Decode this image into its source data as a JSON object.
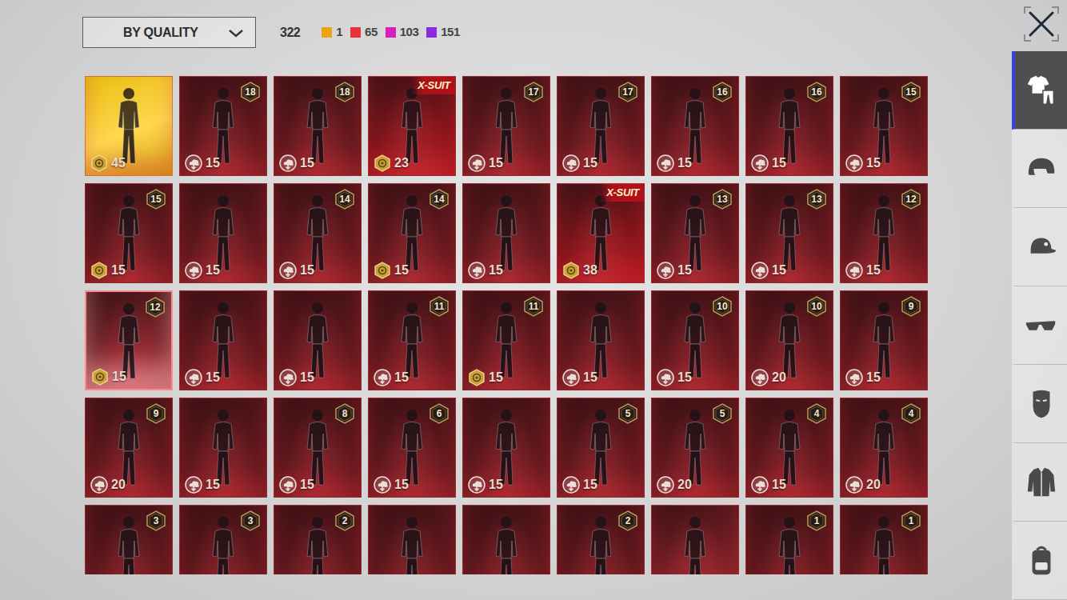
{
  "filter": {
    "label": "BY QUALITY"
  },
  "total": "322",
  "legend": [
    {
      "count": "1",
      "color": "#e8a317"
    },
    {
      "count": "65",
      "color": "#e8313a"
    },
    {
      "count": "103",
      "color": "#d81fbf"
    },
    {
      "count": "151",
      "color": "#8a2be2"
    }
  ],
  "tiles": [
    {
      "color": "#e8b800",
      "selected": false,
      "price": "45",
      "kind": "coin"
    },
    {
      "color": "#6f1b21",
      "selected": false,
      "badge": "18",
      "price": "15",
      "kind": "cloud"
    },
    {
      "color": "#6f1b21",
      "selected": false,
      "badge": "18",
      "price": "15",
      "kind": "cloud"
    },
    {
      "color": "#b3161e",
      "selected": false,
      "tag": "X-SUIT",
      "price": "23",
      "kind": "coin"
    },
    {
      "color": "#6f1b21",
      "selected": false,
      "badge": "17",
      "price": "15",
      "kind": "cloud"
    },
    {
      "color": "#6f1b21",
      "selected": false,
      "badge": "17",
      "price": "15",
      "kind": "cloud"
    },
    {
      "color": "#6f1b21",
      "selected": false,
      "badge": "16",
      "price": "15",
      "kind": "cloud"
    },
    {
      "color": "#6f1b21",
      "selected": false,
      "badge": "16",
      "price": "15",
      "kind": "cloud"
    },
    {
      "color": "#6f1b21",
      "selected": false,
      "badge": "15",
      "price": "15",
      "kind": "cloud"
    },
    {
      "color": "#6f1b21",
      "selected": false,
      "badge": "15",
      "price": "15",
      "kind": "coin"
    },
    {
      "color": "#6f1b21",
      "selected": false,
      "price": "15",
      "kind": "cloud"
    },
    {
      "color": "#6f1b21",
      "selected": false,
      "badge": "14",
      "price": "15",
      "kind": "cloud"
    },
    {
      "color": "#6f1b21",
      "selected": false,
      "badge": "14",
      "price": "15",
      "kind": "coin"
    },
    {
      "color": "#6f1b21",
      "selected": false,
      "price": "15",
      "kind": "cloud"
    },
    {
      "color": "#b3161e",
      "selected": false,
      "tag": "X-SUIT",
      "price": "38",
      "kind": "coin"
    },
    {
      "color": "#6f1b21",
      "selected": false,
      "badge": "13",
      "price": "15",
      "kind": "cloud"
    },
    {
      "color": "#6f1b21",
      "selected": false,
      "badge": "13",
      "price": "15",
      "kind": "cloud"
    },
    {
      "color": "#6f1b21",
      "selected": false,
      "badge": "12",
      "price": "15",
      "kind": "cloud"
    },
    {
      "color": "#a8303a",
      "selected": true,
      "badge": "12",
      "price": "15",
      "kind": "coin"
    },
    {
      "color": "#6f1b21",
      "selected": false,
      "price": "15",
      "kind": "cloud"
    },
    {
      "color": "#6f1b21",
      "selected": false,
      "price": "15",
      "kind": "cloud"
    },
    {
      "color": "#6f1b21",
      "selected": false,
      "badge": "11",
      "price": "15",
      "kind": "cloud"
    },
    {
      "color": "#6f1b21",
      "selected": false,
      "badge": "11",
      "price": "15",
      "kind": "coin"
    },
    {
      "color": "#6f1b21",
      "selected": false,
      "price": "15",
      "kind": "cloud"
    },
    {
      "color": "#6f1b21",
      "selected": false,
      "badge": "10",
      "price": "15",
      "kind": "cloud"
    },
    {
      "color": "#6f1b21",
      "selected": false,
      "badge": "10",
      "price": "20",
      "kind": "cloud"
    },
    {
      "color": "#6f1b21",
      "selected": false,
      "badge": "9",
      "price": "15",
      "kind": "cloud"
    },
    {
      "color": "#6f1b21",
      "selected": false,
      "badge": "9",
      "price": "20",
      "kind": "cloud"
    },
    {
      "color": "#6f1b21",
      "selected": false,
      "price": "15",
      "kind": "cloud"
    },
    {
      "color": "#6f1b21",
      "selected": false,
      "badge": "8",
      "price": "15",
      "kind": "cloud"
    },
    {
      "color": "#6f1b21",
      "selected": false,
      "badge": "6",
      "price": "15",
      "kind": "cloud"
    },
    {
      "color": "#6f1b21",
      "selected": false,
      "price": "15",
      "kind": "cloud"
    },
    {
      "color": "#6f1b21",
      "selected": false,
      "badge": "5",
      "price": "15",
      "kind": "cloud"
    },
    {
      "color": "#6f1b21",
      "selected": false,
      "badge": "5",
      "price": "20",
      "kind": "cloud"
    },
    {
      "color": "#6f1b21",
      "selected": false,
      "badge": "4",
      "price": "15",
      "kind": "cloud"
    },
    {
      "color": "#6f1b21",
      "selected": false,
      "badge": "4",
      "price": "20",
      "kind": "cloud"
    },
    {
      "color": "#6f1b21",
      "selected": false,
      "badge": "3"
    },
    {
      "color": "#6f1b21",
      "selected": false,
      "badge": "3"
    },
    {
      "color": "#6f1b21",
      "selected": false,
      "badge": "2"
    },
    {
      "color": "#6f1b21",
      "selected": false
    },
    {
      "color": "#6f1b21",
      "selected": false
    },
    {
      "color": "#6f1b21",
      "selected": false,
      "badge": "2"
    },
    {
      "color": "#9e2a30",
      "selected": false
    },
    {
      "color": "#6f1b21",
      "selected": false,
      "badge": "1"
    },
    {
      "color": "#6f1b21",
      "selected": false,
      "badge": "1"
    }
  ],
  "tabs": [
    {
      "kind": "outfit",
      "selected": true
    },
    {
      "kind": "helmet",
      "selected": false
    },
    {
      "kind": "hat",
      "selected": false
    },
    {
      "kind": "glasses",
      "selected": false
    },
    {
      "kind": "mask",
      "selected": false
    },
    {
      "kind": "jacket",
      "selected": false
    },
    {
      "kind": "backpack",
      "selected": false
    }
  ]
}
